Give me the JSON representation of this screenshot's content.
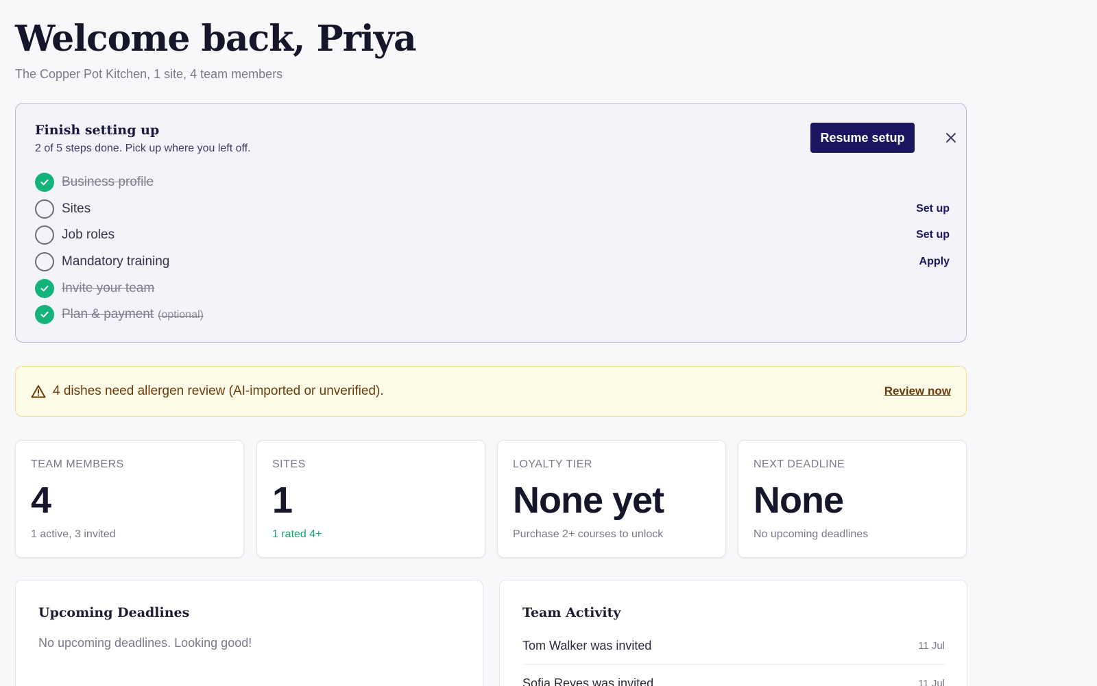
{
  "header": {
    "title": "Welcome back, Priya",
    "subtitle": "The Copper Pot Kitchen, 1 site, 4 team members"
  },
  "setup": {
    "title": "Finish setting up",
    "description": "2 of 5 steps done. Pick up where you left off.",
    "resume_label": "Resume setup",
    "steps": [
      {
        "label": "Business profile",
        "done": true,
        "action": ""
      },
      {
        "label": "Sites",
        "done": false,
        "action": "Set up"
      },
      {
        "label": "Job roles",
        "done": false,
        "action": "Set up"
      },
      {
        "label": "Mandatory training",
        "done": false,
        "action": "Apply"
      },
      {
        "label": "Invite your team",
        "done": true,
        "action": ""
      },
      {
        "label": "Plan & payment",
        "done": true,
        "action": "",
        "optional": "(optional)"
      }
    ]
  },
  "alert": {
    "text": "4 dishes need allergen review (AI-imported or unverified).",
    "link": "Review now"
  },
  "stats": [
    {
      "label": "TEAM MEMBERS",
      "value": "4",
      "note": "1 active, 3 invited"
    },
    {
      "label": "SITES",
      "value": "1",
      "note": "1 rated 4+"
    },
    {
      "label": "LOYALTY TIER",
      "value": "None yet",
      "note": "Purchase 2+ courses to unlock"
    },
    {
      "label": "NEXT DEADLINE",
      "value": "None",
      "note": "No upcoming deadlines"
    }
  ],
  "deadlines": {
    "title": "Upcoming Deadlines",
    "empty": "No upcoming deadlines. Looking good!"
  },
  "activity": {
    "title": "Team Activity",
    "items": [
      {
        "text": "Tom Walker was invited",
        "date": "11 Jul"
      },
      {
        "text": "Sofia Reyes was invited",
        "date": "11 Jul"
      }
    ]
  },
  "colors": {
    "primary": "#1a1660",
    "success": "#15b37c",
    "warning_bg": "#fefae8",
    "warning_text": "#6a3a08"
  },
  "icons": {
    "check": "check-icon",
    "close": "close-icon",
    "warning": "warning-triangle-icon"
  }
}
